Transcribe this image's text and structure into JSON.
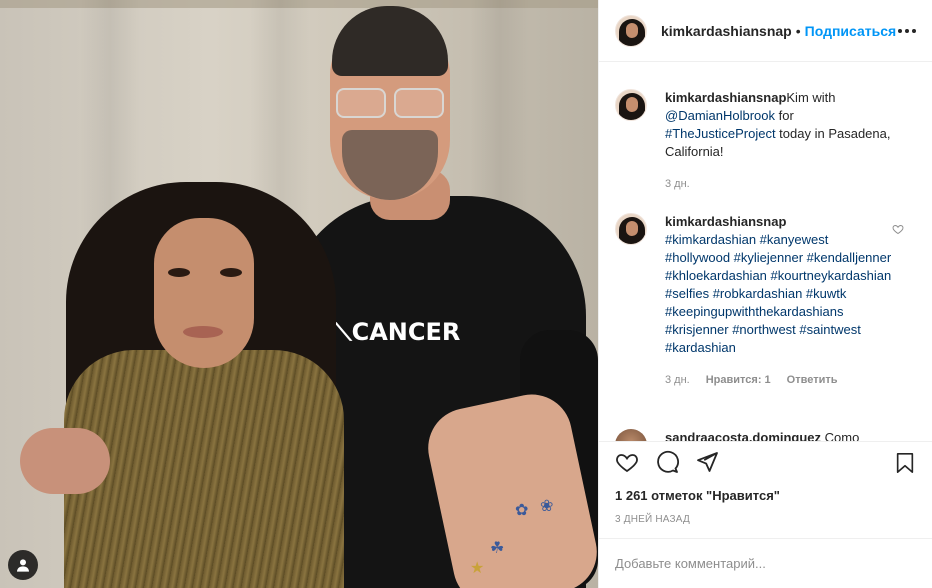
{
  "post": {
    "username": "kimkardashiansnap",
    "follow_label": "Подписаться",
    "separator": "•",
    "photo_text": "CANCER"
  },
  "caption": {
    "username": "kimkardashiansnap",
    "text_before": "Kim with ",
    "mention": "@DamianHolbrook",
    "text_mid": " for ",
    "hashtag": "#TheJusticeProject",
    "text_after": " today in Pasadena, California!",
    "age": "3 дн."
  },
  "comment1": {
    "username": "kimkardashiansnap",
    "hashtags": "#kimkardashian #kanyewest #hollywood #kyliejenner #kendalljenner #khloekardashian #kourtneykardashian #selfies #robkardashian #kuwtk #keepingupwiththekardashians #krisjenner #northwest #saintwest #kardashian",
    "age": "3 дн.",
    "likes_label": "Нравится: 1",
    "reply_label": "Ответить"
  },
  "comment2": {
    "username": "sandraacosta.dominguez",
    "text": "Como"
  },
  "stats": {
    "likes": "1 261 отметок \"Нравится\"",
    "time": "3 ДНЕЙ НАЗАД"
  },
  "input": {
    "placeholder": "Добавьте комментарий..."
  },
  "icons": [
    "heart-icon",
    "comment-icon",
    "share-icon",
    "bookmark-icon",
    "more-icon",
    "user-tag-icon"
  ]
}
